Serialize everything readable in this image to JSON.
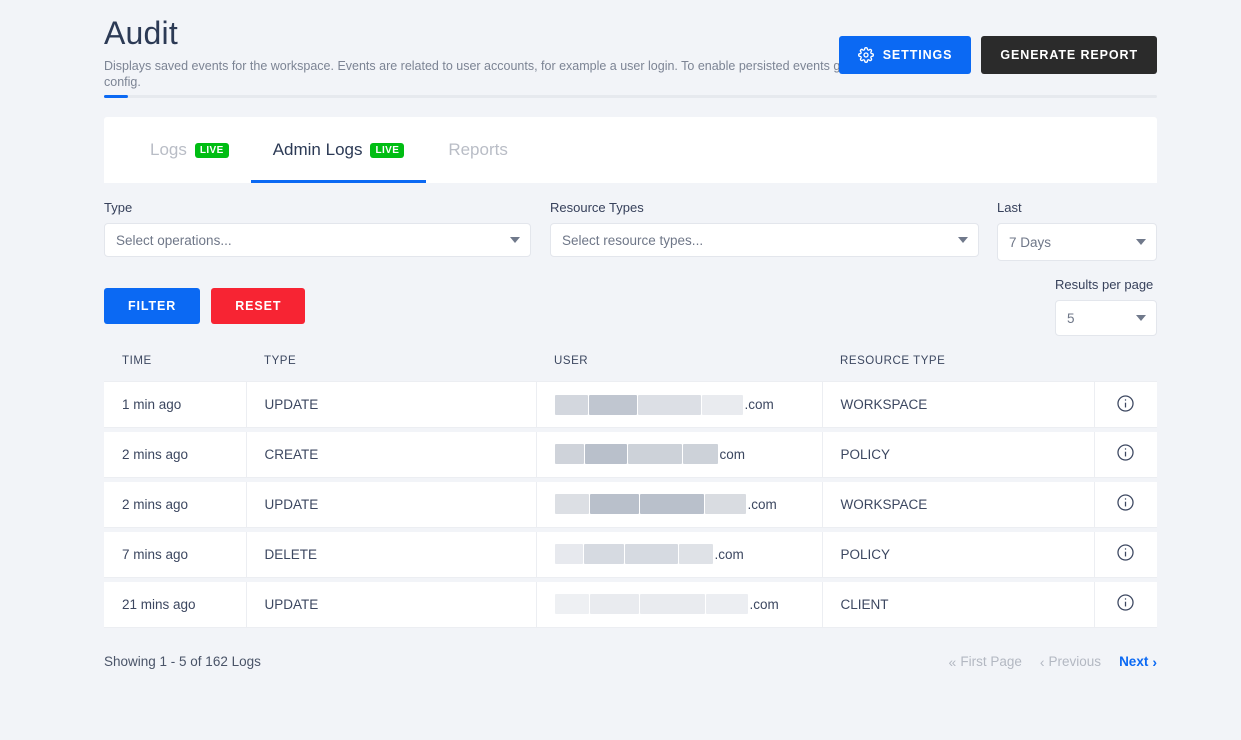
{
  "header": {
    "title": "Audit",
    "subtitle": "Displays saved events for the workspace. Events are related to user accounts, for example a user login. To enable persisted events go to config.",
    "settings_label": "SETTINGS",
    "generate_report_label": "GENERATE REPORT",
    "settings_icon": "gear-icon",
    "accent_color": "#0b69f3",
    "dark_button_color": "#2b2b2b"
  },
  "progress": {
    "fill_percent": 2.3,
    "fill_color": "#0b69f3",
    "track_color": "#e6e9ee"
  },
  "tabs": [
    {
      "label": "Logs",
      "badge": "LIVE",
      "active": false
    },
    {
      "label": "Admin Logs",
      "badge": "LIVE",
      "active": true
    },
    {
      "label": "Reports",
      "badge": null,
      "active": false
    }
  ],
  "badge_color": "#00bd13",
  "filters": {
    "type": {
      "label": "Type",
      "placeholder": "Select operations...",
      "value": ""
    },
    "resource_types": {
      "label": "Resource Types",
      "placeholder": "Select resource types...",
      "value": ""
    },
    "last": {
      "label": "Last",
      "value": "7 Days"
    },
    "filter_button": "FILTER",
    "reset_button": "RESET",
    "filter_color": "#0b69f3",
    "reset_color": "#f72433"
  },
  "results_per_page": {
    "label": "Results per page",
    "value": "5"
  },
  "table": {
    "columns": [
      "TIME",
      "TYPE",
      "USER",
      "RESOURCE TYPE",
      ""
    ],
    "rows": [
      {
        "time": "1 min ago",
        "type": "UPDATE",
        "user_prefix": "",
        "user_redacted_width": 185,
        "user_suffix": ".com",
        "resource_type": "WORKSPACE",
        "info_icon": "info-circle-icon"
      },
      {
        "time": "2 mins ago",
        "type": "CREATE",
        "user_prefix": "",
        "user_redacted_width": 160,
        "user_suffix": "com",
        "resource_type": "POLICY",
        "info_icon": "info-circle-icon"
      },
      {
        "time": "2 mins ago",
        "type": "UPDATE",
        "user_prefix": "",
        "user_redacted_width": 188,
        "user_suffix": ".com",
        "resource_type": "WORKSPACE",
        "info_icon": "info-circle-icon"
      },
      {
        "time": "7 mins ago",
        "type": "DELETE",
        "user_prefix": "",
        "user_redacted_width": 155,
        "user_suffix": ".com",
        "resource_type": "POLICY",
        "info_icon": "info-circle-icon"
      },
      {
        "time": "21 mins ago",
        "type": "UPDATE",
        "user_prefix": "",
        "user_redacted_width": 190,
        "user_suffix": ".com",
        "resource_type": "CLIENT",
        "info_icon": "info-circle-icon"
      }
    ]
  },
  "footer": {
    "showing": "Showing 1 - 5 of 162 Logs",
    "first_page": "First Page",
    "previous": "Previous",
    "next": "Next"
  }
}
